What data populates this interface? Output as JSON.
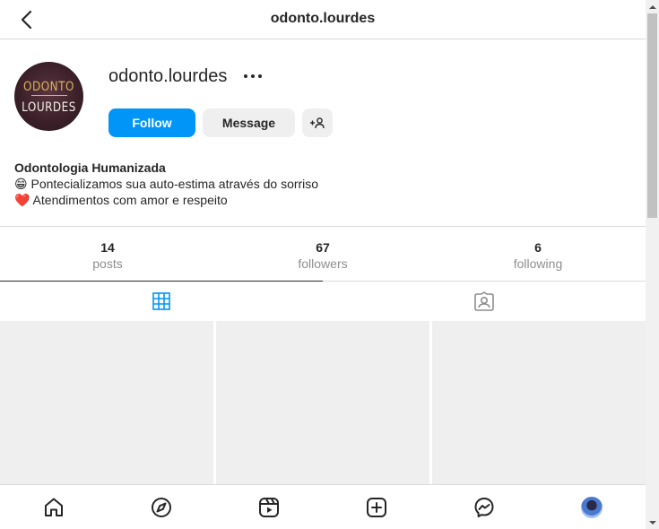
{
  "header": {
    "title": "odonto.lourdes",
    "back_icon": "chevron-left-icon"
  },
  "profile": {
    "username": "odonto.lourdes",
    "avatar_line1": "ODONTO",
    "avatar_line2": "LOURDES",
    "follow_label": "Follow",
    "message_label": "Message",
    "more_icon": "more-dots-icon",
    "add_user_icon": "add-user-icon"
  },
  "bio": {
    "name": "Odontologia Humanizada",
    "line1": "😁 Pontecializamos sua auto-estima através do sorriso",
    "line2": "❤️ Atendimentos com amor e respeito"
  },
  "stats": [
    {
      "value": "14",
      "label": "posts"
    },
    {
      "value": "67",
      "label": "followers"
    },
    {
      "value": "6",
      "label": "following"
    }
  ],
  "tabs": [
    {
      "icon": "grid-icon",
      "active": true
    },
    {
      "icon": "tagged-icon",
      "active": false
    }
  ],
  "nav": [
    {
      "icon": "home-icon"
    },
    {
      "icon": "explore-icon"
    },
    {
      "icon": "reels-icon"
    },
    {
      "icon": "new-post-icon"
    },
    {
      "icon": "messenger-icon"
    },
    {
      "icon": "profile-avatar-icon"
    }
  ],
  "colors": {
    "accent": "#0095f6",
    "text": "#262626",
    "muted": "#8e8e8e",
    "border": "#dbdbdb",
    "placeholder": "#efefef"
  }
}
